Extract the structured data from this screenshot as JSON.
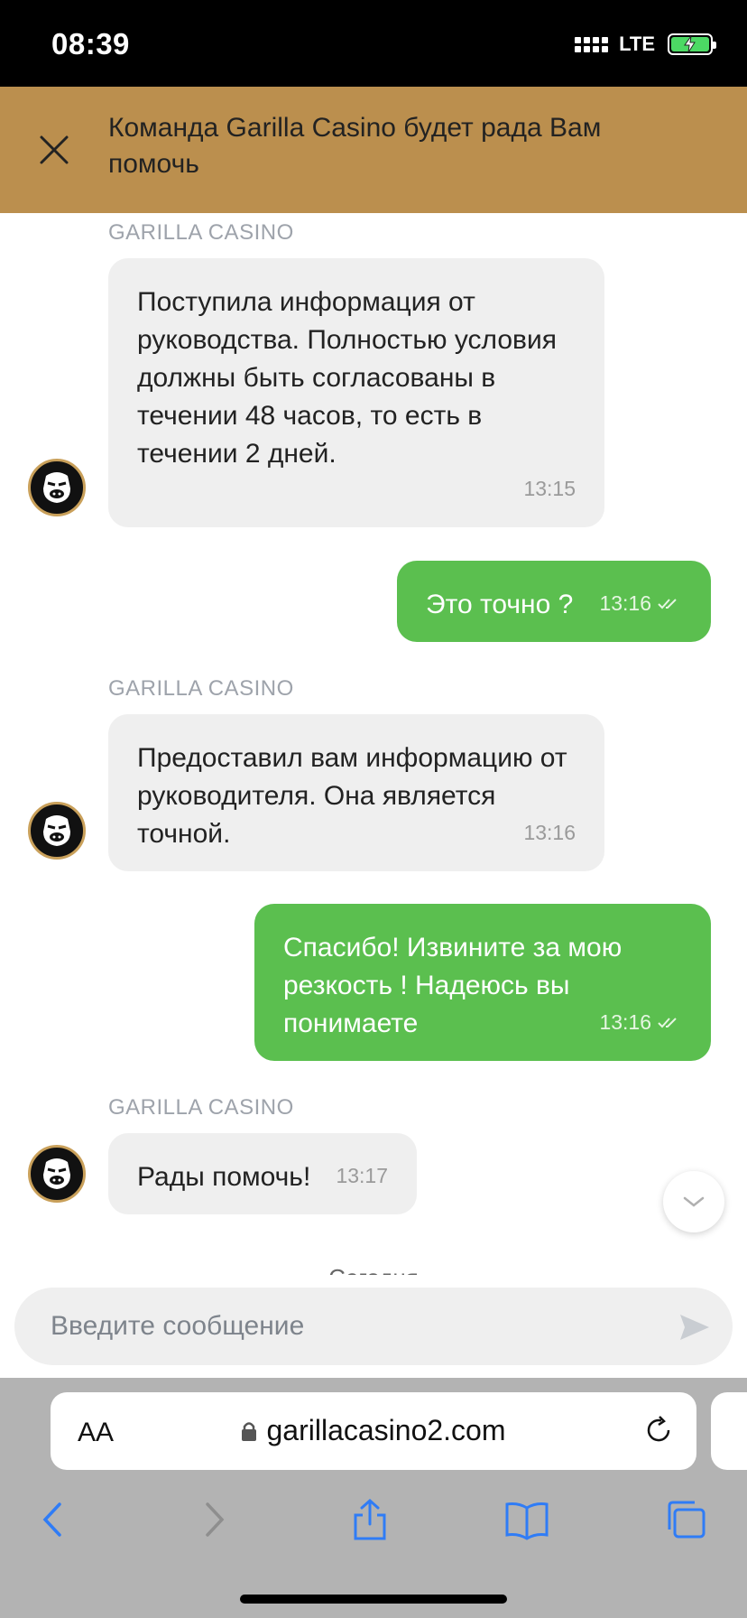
{
  "status_bar": {
    "time": "08:39",
    "network": "LTE"
  },
  "header": {
    "title": "Команда Garilla Casino будет рада Вам помочь"
  },
  "messages": [
    {
      "sender": "GARILLA CASINO",
      "text": "Поступила информация от руководства. Полностью условия должны быть согласованы в течении 48 часов, то есть в течении 2 дней.",
      "time": "13:15"
    },
    {
      "text": "Это точно ?",
      "time": "13:16"
    },
    {
      "sender": "GARILLA CASINO",
      "text": "Предоставил вам информацию от руководителя. Она является точной.",
      "time": "13:16"
    },
    {
      "text": "Спасибо! Извините за мою резкость ! Надеюсь вы понимаете",
      "time": "13:16"
    },
    {
      "sender": "GARILLA CASINO",
      "text": "Рады помочь!",
      "time": "13:17"
    }
  ],
  "divider": "Сегодня",
  "composer": {
    "placeholder": "Введите сообщение"
  },
  "browser": {
    "aa": "AA",
    "url": "garillacasino2.com"
  },
  "colors": {
    "header": "#bb8f4e",
    "outgoing": "#5bbf4f",
    "incoming": "#efefef"
  }
}
